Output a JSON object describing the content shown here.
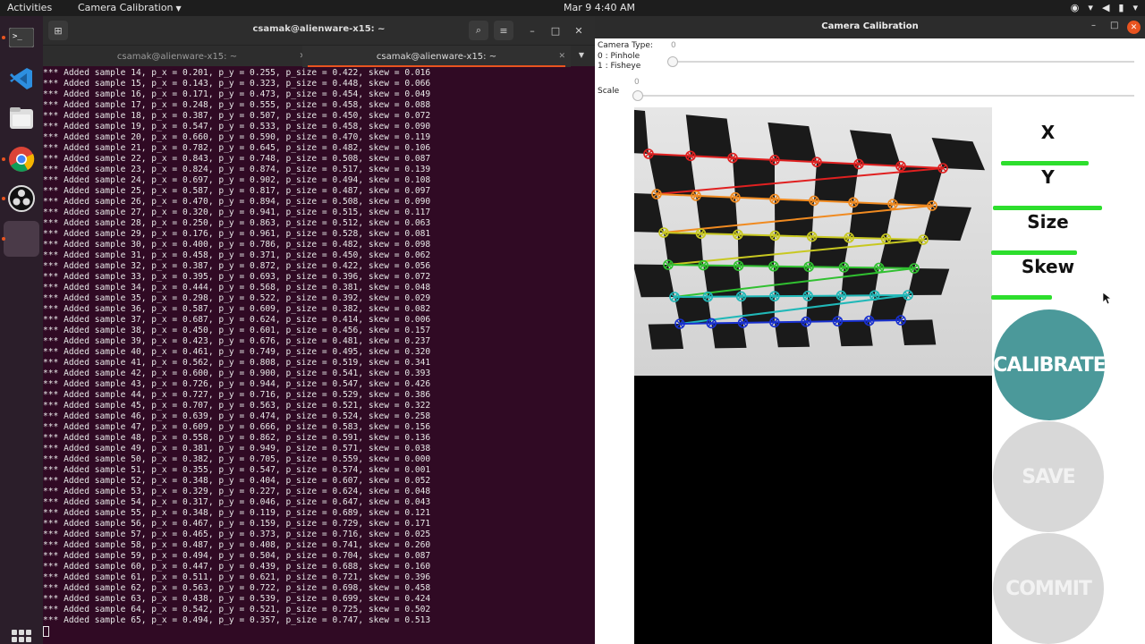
{
  "topbar": {
    "activities": "Activities",
    "app_menu": "Camera Calibration",
    "clock": "Mar 9  4:40 AM"
  },
  "dock": {
    "items": [
      "terminal",
      "vscode",
      "files",
      "chrome",
      "obs",
      "app-window"
    ]
  },
  "terminal": {
    "title": "csamak@alienware-x15: ~",
    "tabs": [
      {
        "label": "csamak@alienware-x15: ~",
        "active": false
      },
      {
        "label": "csamak@alienware-x15: ~",
        "active": true
      }
    ],
    "lines": [
      "*** Added sample 14, p_x = 0.201, p_y = 0.255, p_size = 0.422, skew = 0.016",
      "*** Added sample 15, p_x = 0.143, p_y = 0.323, p_size = 0.448, skew = 0.066",
      "*** Added sample 16, p_x = 0.171, p_y = 0.473, p_size = 0.454, skew = 0.049",
      "*** Added sample 17, p_x = 0.248, p_y = 0.555, p_size = 0.458, skew = 0.088",
      "*** Added sample 18, p_x = 0.387, p_y = 0.507, p_size = 0.450, skew = 0.072",
      "*** Added sample 19, p_x = 0.547, p_y = 0.533, p_size = 0.458, skew = 0.090",
      "*** Added sample 20, p_x = 0.660, p_y = 0.590, p_size = 0.470, skew = 0.119",
      "*** Added sample 21, p_x = 0.782, p_y = 0.645, p_size = 0.482, skew = 0.106",
      "*** Added sample 22, p_x = 0.843, p_y = 0.748, p_size = 0.508, skew = 0.087",
      "*** Added sample 23, p_x = 0.824, p_y = 0.874, p_size = 0.517, skew = 0.139",
      "*** Added sample 24, p_x = 0.697, p_y = 0.902, p_size = 0.494, skew = 0.108",
      "*** Added sample 25, p_x = 0.587, p_y = 0.817, p_size = 0.487, skew = 0.097",
      "*** Added sample 26, p_x = 0.470, p_y = 0.894, p_size = 0.508, skew = 0.090",
      "*** Added sample 27, p_x = 0.320, p_y = 0.941, p_size = 0.515, skew = 0.117",
      "*** Added sample 28, p_x = 0.250, p_y = 0.863, p_size = 0.512, skew = 0.063",
      "*** Added sample 29, p_x = 0.176, p_y = 0.961, p_size = 0.528, skew = 0.081",
      "*** Added sample 30, p_x = 0.400, p_y = 0.786, p_size = 0.482, skew = 0.098",
      "*** Added sample 31, p_x = 0.458, p_y = 0.371, p_size = 0.450, skew = 0.062",
      "*** Added sample 32, p_x = 0.387, p_y = 0.872, p_size = 0.422, skew = 0.056",
      "*** Added sample 33, p_x = 0.395, p_y = 0.693, p_size = 0.396, skew = 0.072",
      "*** Added sample 34, p_x = 0.444, p_y = 0.568, p_size = 0.381, skew = 0.048",
      "*** Added sample 35, p_x = 0.298, p_y = 0.522, p_size = 0.392, skew = 0.029",
      "*** Added sample 36, p_x = 0.587, p_y = 0.609, p_size = 0.382, skew = 0.082",
      "*** Added sample 37, p_x = 0.687, p_y = 0.624, p_size = 0.414, skew = 0.006",
      "*** Added sample 38, p_x = 0.450, p_y = 0.601, p_size = 0.456, skew = 0.157",
      "*** Added sample 39, p_x = 0.423, p_y = 0.676, p_size = 0.481, skew = 0.237",
      "*** Added sample 40, p_x = 0.461, p_y = 0.749, p_size = 0.495, skew = 0.320",
      "*** Added sample 41, p_x = 0.562, p_y = 0.808, p_size = 0.519, skew = 0.341",
      "*** Added sample 42, p_x = 0.600, p_y = 0.900, p_size = 0.541, skew = 0.393",
      "*** Added sample 43, p_x = 0.726, p_y = 0.944, p_size = 0.547, skew = 0.426",
      "*** Added sample 44, p_x = 0.727, p_y = 0.716, p_size = 0.529, skew = 0.386",
      "*** Added sample 45, p_x = 0.707, p_y = 0.563, p_size = 0.521, skew = 0.322",
      "*** Added sample 46, p_x = 0.639, p_y = 0.474, p_size = 0.524, skew = 0.258",
      "*** Added sample 47, p_x = 0.609, p_y = 0.666, p_size = 0.583, skew = 0.156",
      "*** Added sample 48, p_x = 0.558, p_y = 0.862, p_size = 0.591, skew = 0.136",
      "*** Added sample 49, p_x = 0.381, p_y = 0.949, p_size = 0.571, skew = 0.038",
      "*** Added sample 50, p_x = 0.382, p_y = 0.705, p_size = 0.559, skew = 0.000",
      "*** Added sample 51, p_x = 0.355, p_y = 0.547, p_size = 0.574, skew = 0.001",
      "*** Added sample 52, p_x = 0.348, p_y = 0.404, p_size = 0.607, skew = 0.052",
      "*** Added sample 53, p_x = 0.329, p_y = 0.227, p_size = 0.624, skew = 0.048",
      "*** Added sample 54, p_x = 0.317, p_y = 0.046, p_size = 0.647, skew = 0.043",
      "*** Added sample 55, p_x = 0.348, p_y = 0.119, p_size = 0.689, skew = 0.121",
      "*** Added sample 56, p_x = 0.467, p_y = 0.159, p_size = 0.729, skew = 0.171",
      "*** Added sample 57, p_x = 0.465, p_y = 0.373, p_size = 0.716, skew = 0.025",
      "*** Added sample 58, p_x = 0.487, p_y = 0.408, p_size = 0.741, skew = 0.260",
      "*** Added sample 59, p_x = 0.494, p_y = 0.504, p_size = 0.704, skew = 0.087",
      "*** Added sample 60, p_x = 0.447, p_y = 0.439, p_size = 0.688, skew = 0.160",
      "*** Added sample 61, p_x = 0.511, p_y = 0.621, p_size = 0.721, skew = 0.396",
      "*** Added sample 62, p_x = 0.563, p_y = 0.722, p_size = 0.698, skew = 0.458",
      "*** Added sample 63, p_x = 0.438, p_y = 0.539, p_size = 0.699, skew = 0.424",
      "*** Added sample 64, p_x = 0.542, p_y = 0.521, p_size = 0.725, skew = 0.502",
      "*** Added sample 65, p_x = 0.494, p_y = 0.357, p_size = 0.747, skew = 0.513"
    ]
  },
  "calib": {
    "title": "Camera Calibration",
    "camera_type": {
      "label": "Camera Type:",
      "opt0": "0 : Pinhole",
      "opt1": "1 : Fisheye",
      "value": "0"
    },
    "scale": {
      "label": "Scale",
      "value": "0"
    },
    "metrics": {
      "x": {
        "label": "X",
        "level": 0.8
      },
      "y": {
        "label": "Y",
        "level": 0.99
      },
      "size": {
        "label": "Size",
        "level": 0.78
      },
      "skew": {
        "label": "Skew",
        "level": 0.55
      }
    },
    "buttons": {
      "calibrate": "CALIBRATE",
      "save": "SAVE",
      "commit": "COMMIT"
    },
    "colors": {
      "calibrate_bg": "#4b999a",
      "disabled_bg": "#d8d8d8",
      "progress": "#2dde2d",
      "terminal_bg": "#300a24",
      "accent": "#e95420"
    }
  }
}
